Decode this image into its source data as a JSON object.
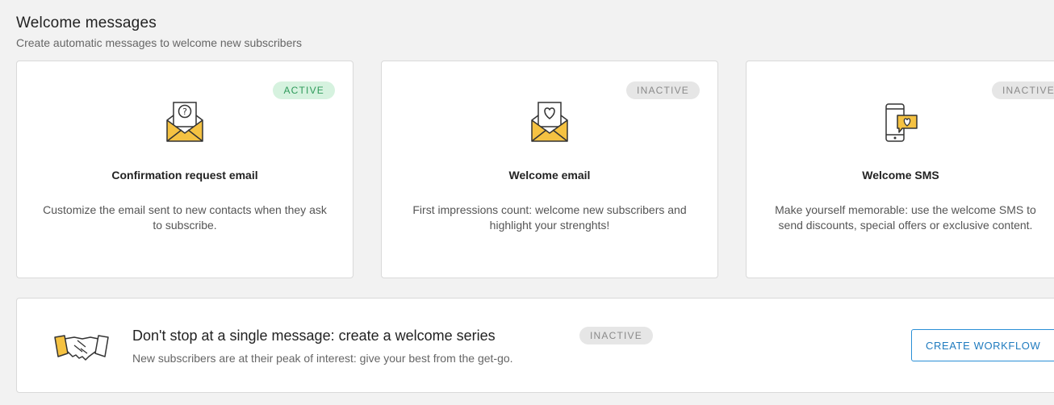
{
  "header": {
    "title": "Welcome messages",
    "subtitle": "Create automatic messages to welcome new subscribers"
  },
  "cards": [
    {
      "badge": "ACTIVE",
      "icon": "envelope-question-icon",
      "title": "Confirmation request email",
      "description": "Customize the email sent to new contacts when they ask to subscribe."
    },
    {
      "badge": "INACTIVE",
      "icon": "envelope-heart-icon",
      "title": "Welcome email",
      "description": "First impressions count: welcome new subscribers and highlight your strenghts!"
    },
    {
      "badge": "INACTIVE",
      "icon": "phone-heart-message-icon",
      "title": "Welcome SMS",
      "description": "Make yourself memorable: use the welcome SMS to send discounts, special offers or exclusive content."
    }
  ],
  "series": {
    "icon": "handshake-icon",
    "title": "Don't stop at a single message: create a welcome series",
    "badge": "INACTIVE",
    "description": "New subscribers are at their peak of interest: give your best from the get-go.",
    "button_label": "CREATE WORKFLOW"
  },
  "colors": {
    "accent_yellow": "#f5c242",
    "active_green": "#2e9a5a",
    "button_blue": "#1f7bbf"
  }
}
